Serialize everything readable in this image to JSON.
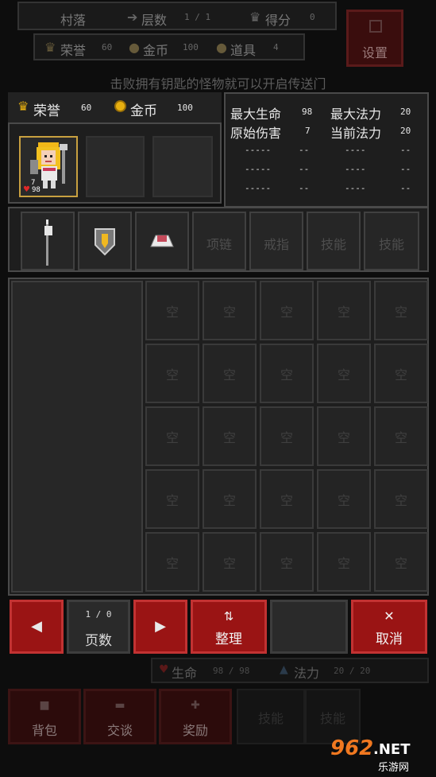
{
  "top_bar": {
    "village": "村落",
    "floor_label": "层数",
    "floor_value": "1 / 1",
    "score_label": "得分",
    "score_value": "0",
    "honor_label": "荣誉",
    "honor_value": "60",
    "gold_label": "金币",
    "gold_value": "100",
    "items_label": "道具",
    "items_value": "4",
    "settings": "设置"
  },
  "hint": "击败拥有钥匙的怪物就可以开启传送门",
  "hero": {
    "honor_label": "荣誉",
    "honor_value": "60",
    "gold_label": "金币",
    "gold_value": "100",
    "portrait_attack": "7",
    "portrait_hp": "98"
  },
  "stats": {
    "max_hp_label": "最大生命",
    "max_hp": "98",
    "max_mp_label": "最大法力",
    "max_mp": "20",
    "base_dmg_label": "原始伤害",
    "base_dmg": "7",
    "cur_mp_label": "当前法力",
    "cur_mp": "20",
    "empty_long": "-----",
    "empty_short": "--",
    "empty_long2": "----"
  },
  "equipment": {
    "weapon_icon": "halberd-icon",
    "shield_icon": "shield-icon",
    "armor_icon": "armor-icon",
    "necklace": "项链",
    "ring": "戒指",
    "skill1": "技能",
    "skill2": "技能"
  },
  "inventory": {
    "empty_label": "空",
    "page_value": "1 / 0",
    "page_label": "页数",
    "sort_label": "整理",
    "cancel_label": "取消",
    "prev_glyph": "◀",
    "next_glyph": "▶",
    "sort_glyph": "⇅",
    "cancel_glyph": "✕"
  },
  "bottom_bar": {
    "hp_label": "生命",
    "hp_value": "98 / 98",
    "mp_label": "法力",
    "mp_value": "20 / 20",
    "bag": "背包",
    "talk": "交谈",
    "reward": "奖励",
    "skill_a": "技能",
    "skill_b": "技能"
  },
  "watermark": {
    "brand": "962",
    "net": ".NET",
    "site": "乐游网"
  },
  "colors": {
    "accent_red": "#9a1414",
    "gold": "#e8b010",
    "panel": "#1e1e1e"
  }
}
